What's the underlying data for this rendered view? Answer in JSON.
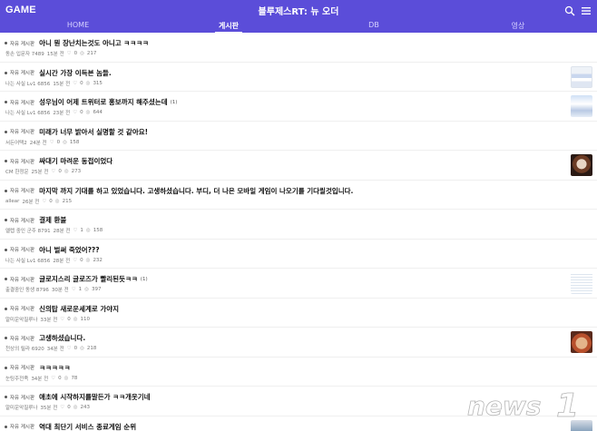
{
  "header": {
    "brand": "GAME",
    "app_title": "블루제스RT: 뉴 오더",
    "tabs": [
      {
        "label": "HOME",
        "active": false
      },
      {
        "label": "게시판",
        "active": true
      },
      {
        "label": "DB",
        "active": false
      },
      {
        "label": "영상",
        "active": false
      }
    ],
    "icons": [
      "search-icon",
      "menu-icon"
    ],
    "accent_color": "#5b4dd9"
  },
  "posts": [
    {
      "category": "자유 게시판",
      "title": "아니 뭔 장난치는것도 아니고 ㅋㅋㅋㅋ",
      "comments": "",
      "author": "동손 입문자 7489",
      "time": "15분 전",
      "likes": "0",
      "views": "217",
      "thumb": ""
    },
    {
      "category": "자유 게시판",
      "title": "실시간 가장 이득본 놈들.",
      "comments": "",
      "author": "나는 사실 Lv1 6856",
      "time": "15분 전",
      "likes": "0",
      "views": "315",
      "thumb": "t1"
    },
    {
      "category": "자유 게시판",
      "title": "성우님이 어제 트위터로 홍보까지 해주셨는데",
      "comments": "(1)",
      "author": "나는 사실 Lv1 6856",
      "time": "23분 전",
      "likes": "0",
      "views": "644",
      "thumb": "t2"
    },
    {
      "category": "자유 게시판",
      "title": "미래가 너무 밝아서 실명할 것 같아요!",
      "comments": "",
      "author": "서든어택2",
      "time": "24분 전",
      "likes": "0",
      "views": "158",
      "thumb": ""
    },
    {
      "category": "자유 게시판",
      "title": "싸대기 마려운 동접이었다",
      "comments": "",
      "author": "CM 한정운",
      "time": "25분 전",
      "likes": "0",
      "views": "273",
      "thumb": "t3"
    },
    {
      "category": "자유 게시판",
      "title": "마지막 까지 기대를 하고 있었습니다. 고생하셨습니다. 부디, 더 나은 모바일 게임이 나오기를 기다릴것입니다.",
      "comments": "",
      "author": "allear",
      "time": "26분 전",
      "likes": "0",
      "views": "215",
      "thumb": ""
    },
    {
      "category": "자유 게시판",
      "title": "결제 환불",
      "comments": "",
      "author": "엘렙 중인 군주 8791",
      "time": "28분 전",
      "likes": "1",
      "views": "158",
      "thumb": ""
    },
    {
      "category": "자유 게시판",
      "title": "아니 벌써 죽었어???",
      "comments": "",
      "author": "나는 사실 Lv1 6856",
      "time": "28분 전",
      "likes": "0",
      "views": "232",
      "thumb": ""
    },
    {
      "category": "자유 게시판",
      "title": "글로지스리 글로즈가 빨리된듯ㅋㅋ",
      "comments": "(1)",
      "author": "출결중인 동생 8796",
      "time": "30분 전",
      "likes": "1",
      "views": "397",
      "thumb": "t4"
    },
    {
      "category": "자유 게시판",
      "title": "신의탑 새로운세계로 가야지",
      "comments": "",
      "author": "알미운악질루나",
      "time": "33분 전",
      "likes": "0",
      "views": "110",
      "thumb": ""
    },
    {
      "category": "자유 게시판",
      "title": "고생하셨습니다.",
      "comments": "",
      "author": "천상의 릴라 6920",
      "time": "34분 전",
      "likes": "0",
      "views": "218",
      "thumb": "t5"
    },
    {
      "category": "자유 게시판",
      "title": "ㅋㅋㅋㅋㅋ",
      "comments": "",
      "author": "눈팅주전족",
      "time": "34분 전",
      "likes": "0",
      "views": "78",
      "thumb": ""
    },
    {
      "category": "자유 게시판",
      "title": "애초에 시작하지를말든가 ㅋㅋ개웃기네",
      "comments": "",
      "author": "알미운악질루나",
      "time": "35분 전",
      "likes": "0",
      "views": "243",
      "thumb": ""
    },
    {
      "category": "자유 게시판",
      "title": "역대 최단기 서비스 종료게임 순위",
      "comments": "",
      "author": "",
      "time": "",
      "likes": "",
      "views": "",
      "thumb": "t6"
    }
  ],
  "watermark": {
    "text": "news1"
  }
}
